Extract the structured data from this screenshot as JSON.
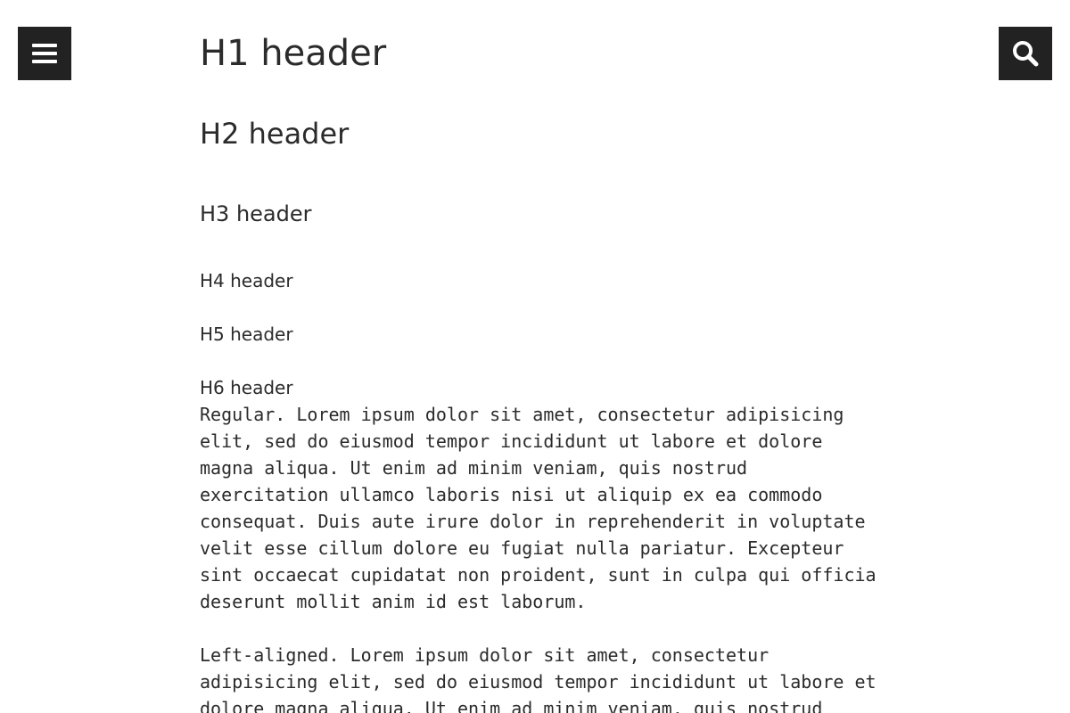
{
  "header": {
    "menu_icon": "hamburger-menu-icon",
    "search_icon": "search-icon",
    "icon_bg": "#222222",
    "icon_fg": "#ffffff"
  },
  "headings": {
    "h1": "H1 header",
    "h2": "H2 header",
    "h3": "H3 header",
    "h4": "H4 header",
    "h5": "H5 header",
    "h6": "H6 header"
  },
  "paragraphs": {
    "regular": "Regular. Lorem ipsum dolor sit amet, consectetur adipisicing elit, sed do eiusmod tempor incididunt ut labore et dolore magna aliqua. Ut enim ad minim veniam, quis nostrud exercitation ullamco laboris nisi ut aliquip ex ea commodo consequat. Duis aute irure dolor in reprehenderit in voluptate velit esse cillum dolore eu fugiat nulla pariatur. Excepteur sint occaecat cupidatat non proident, sunt in culpa qui officia deserunt mollit anim id est laborum.",
    "left_aligned": "Left-aligned. Lorem ipsum dolor sit amet, consectetur adipisicing elit, sed do eiusmod tempor incididunt ut labore et dolore magna aliqua. Ut enim ad minim veniam, quis nostrud"
  },
  "colors": {
    "text": "#2b2b2b",
    "background": "#ffffff"
  }
}
